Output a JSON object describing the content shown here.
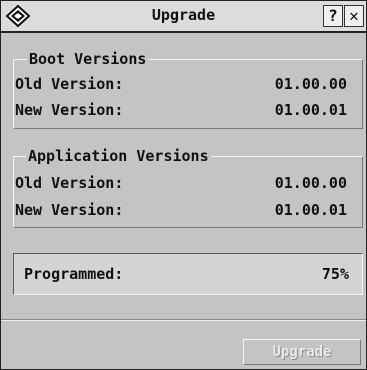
{
  "window": {
    "title": "Upgrade",
    "help_label": "?",
    "close_label": "✕",
    "icon": "diamond-logo-icon"
  },
  "boot": {
    "legend": "Boot Versions",
    "old_label": "Old Version:",
    "old_value": "01.00.00",
    "new_label": "New Version:",
    "new_value": "01.00.01"
  },
  "app": {
    "legend": "Application Versions",
    "old_label": "Old Version:",
    "old_value": "01.00.00",
    "new_label": "New Version:",
    "new_value": "01.00.01"
  },
  "progress": {
    "label": "Programmed:",
    "value": "75%",
    "fraction": 0.75
  },
  "upgrade_button": {
    "label": "Upgrade",
    "enabled": false
  },
  "colors": {
    "background": "#c4c4c4",
    "titlebar": "#dcdcdc",
    "text": "#111111",
    "disabled_text": "#e9e9e9"
  }
}
